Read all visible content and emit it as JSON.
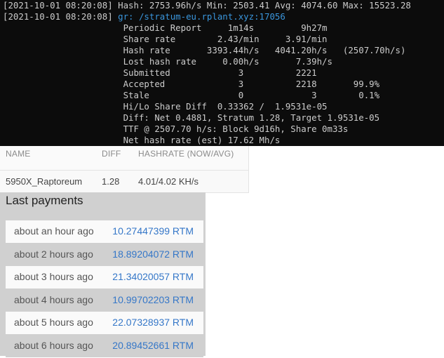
{
  "terminal": {
    "lines": [
      {
        "ts": "[2021-10-01 08:20:08]",
        "text": " Hash: 2753.96h/s Min: 2503.41 Avg: 4074.60 Max: 15523.28"
      },
      {
        "ts": "[2021-10-01 08:20:08]",
        "text": " gr: /stratum-eu.rplant.xyz:17056",
        "url": true
      },
      {
        "ts": "",
        "text": "                       Periodic Report     1m14s         9h27m"
      },
      {
        "ts": "",
        "text": "                       Share rate        2.43/min     3.91/min"
      },
      {
        "ts": "",
        "text": "                       Hash rate       3393.44h/s   4041.20h/s   (2507.70h/s)"
      },
      {
        "ts": "",
        "text": "                       Lost hash rate     0.00h/s       7.39h/s"
      },
      {
        "ts": "",
        "text": "                       Submitted             3          2221"
      },
      {
        "ts": "",
        "text": "                       Accepted              3          2218       99.9%"
      },
      {
        "ts": "",
        "text": "                       Stale                 0             3        0.1%"
      },
      {
        "ts": "",
        "text": "                       Hi/Lo Share Diff  0.33362 /  1.9531e-05"
      },
      {
        "ts": "",
        "text": "                       Diff: Net 0.4881, Stratum 1.28, Target 1.9531e-05"
      },
      {
        "ts": "",
        "text": "                       TTF @ 2507.70 h/s: Block 9d16h, Share 0m33s"
      },
      {
        "ts": "",
        "text": "                       Net hash rate (est) 17.62 Mh/s"
      }
    ]
  },
  "workers": {
    "headers": {
      "name": "NAME",
      "diff": "DIFF",
      "hashrate": "HASHRATE (NOW/AVG)"
    },
    "row": {
      "name": "5950X_Raptoreum",
      "diff": "1.28",
      "hashrate": "4.01/4.02 KH/s"
    }
  },
  "payments": {
    "title": "Last payments",
    "rows": [
      {
        "time": "about an hour ago",
        "amount": "10.27447399 RTM"
      },
      {
        "time": "about 2 hours ago",
        "amount": "18.89204072 RTM"
      },
      {
        "time": "about 3 hours ago",
        "amount": "21.34020057 RTM"
      },
      {
        "time": "about 4 hours ago",
        "amount": "10.99702203 RTM"
      },
      {
        "time": "about 5 hours ago",
        "amount": "22.07328937 RTM"
      },
      {
        "time": "about 6 hours ago",
        "amount": "20.89452661 RTM"
      }
    ]
  }
}
